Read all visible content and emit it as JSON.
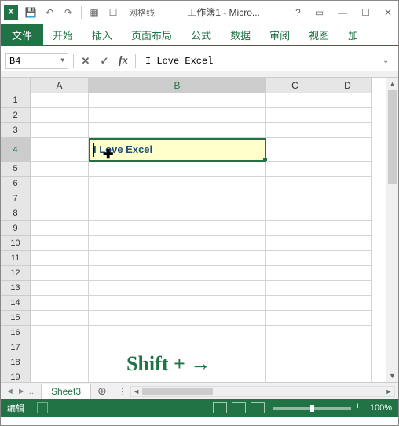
{
  "titlebar": {
    "gridlines_label": "网格线",
    "title": "工作簿1 - Micro..."
  },
  "ribbon": {
    "file": "文件",
    "tabs": [
      "开始",
      "插入",
      "页面布局",
      "公式",
      "数据",
      "审阅",
      "视图",
      "加"
    ]
  },
  "formula_bar": {
    "name_box": "B4",
    "fx": "fx",
    "value": "I Love Excel"
  },
  "columns": [
    "A",
    "B",
    "C",
    "D"
  ],
  "rows": [
    "1",
    "2",
    "3",
    "4",
    "5",
    "6",
    "7",
    "8",
    "9",
    "10",
    "11",
    "12",
    "13",
    "14",
    "15",
    "16",
    "17",
    "18",
    "19"
  ],
  "cell_B4": "I Love Excel",
  "annotation": "Shift + →",
  "sheet": {
    "active": "Sheet3",
    "nav_dots": "..."
  },
  "status": {
    "mode": "编辑",
    "zoom": "100%"
  }
}
